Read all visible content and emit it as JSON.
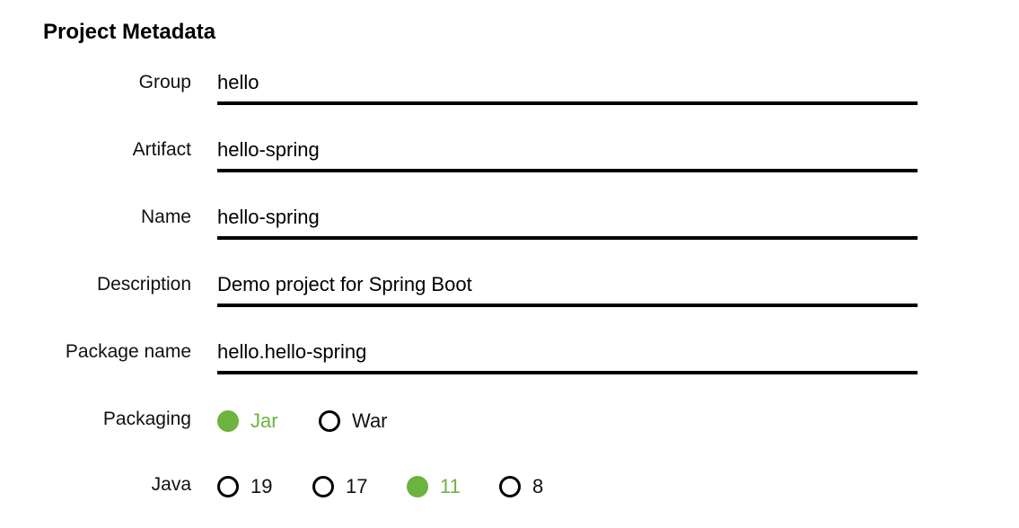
{
  "section": {
    "title": "Project Metadata"
  },
  "fields": {
    "group": {
      "label": "Group",
      "value": "hello"
    },
    "artifact": {
      "label": "Artifact",
      "value": "hello-spring"
    },
    "name": {
      "label": "Name",
      "value": "hello-spring"
    },
    "description": {
      "label": "Description",
      "value": "Demo project for Spring Boot"
    },
    "package_name": {
      "label": "Package name",
      "value": "hello.hello-spring"
    }
  },
  "packaging": {
    "label": "Packaging",
    "selected": "Jar",
    "options": [
      {
        "label": "Jar",
        "selected": true
      },
      {
        "label": "War",
        "selected": false
      }
    ]
  },
  "java": {
    "label": "Java",
    "selected": "11",
    "options": [
      {
        "label": "19",
        "selected": false
      },
      {
        "label": "17",
        "selected": false
      },
      {
        "label": "11",
        "selected": true
      },
      {
        "label": "8",
        "selected": false
      }
    ]
  },
  "colors": {
    "accent": "#6db33f",
    "text": "#000000",
    "underline": "#000000"
  }
}
